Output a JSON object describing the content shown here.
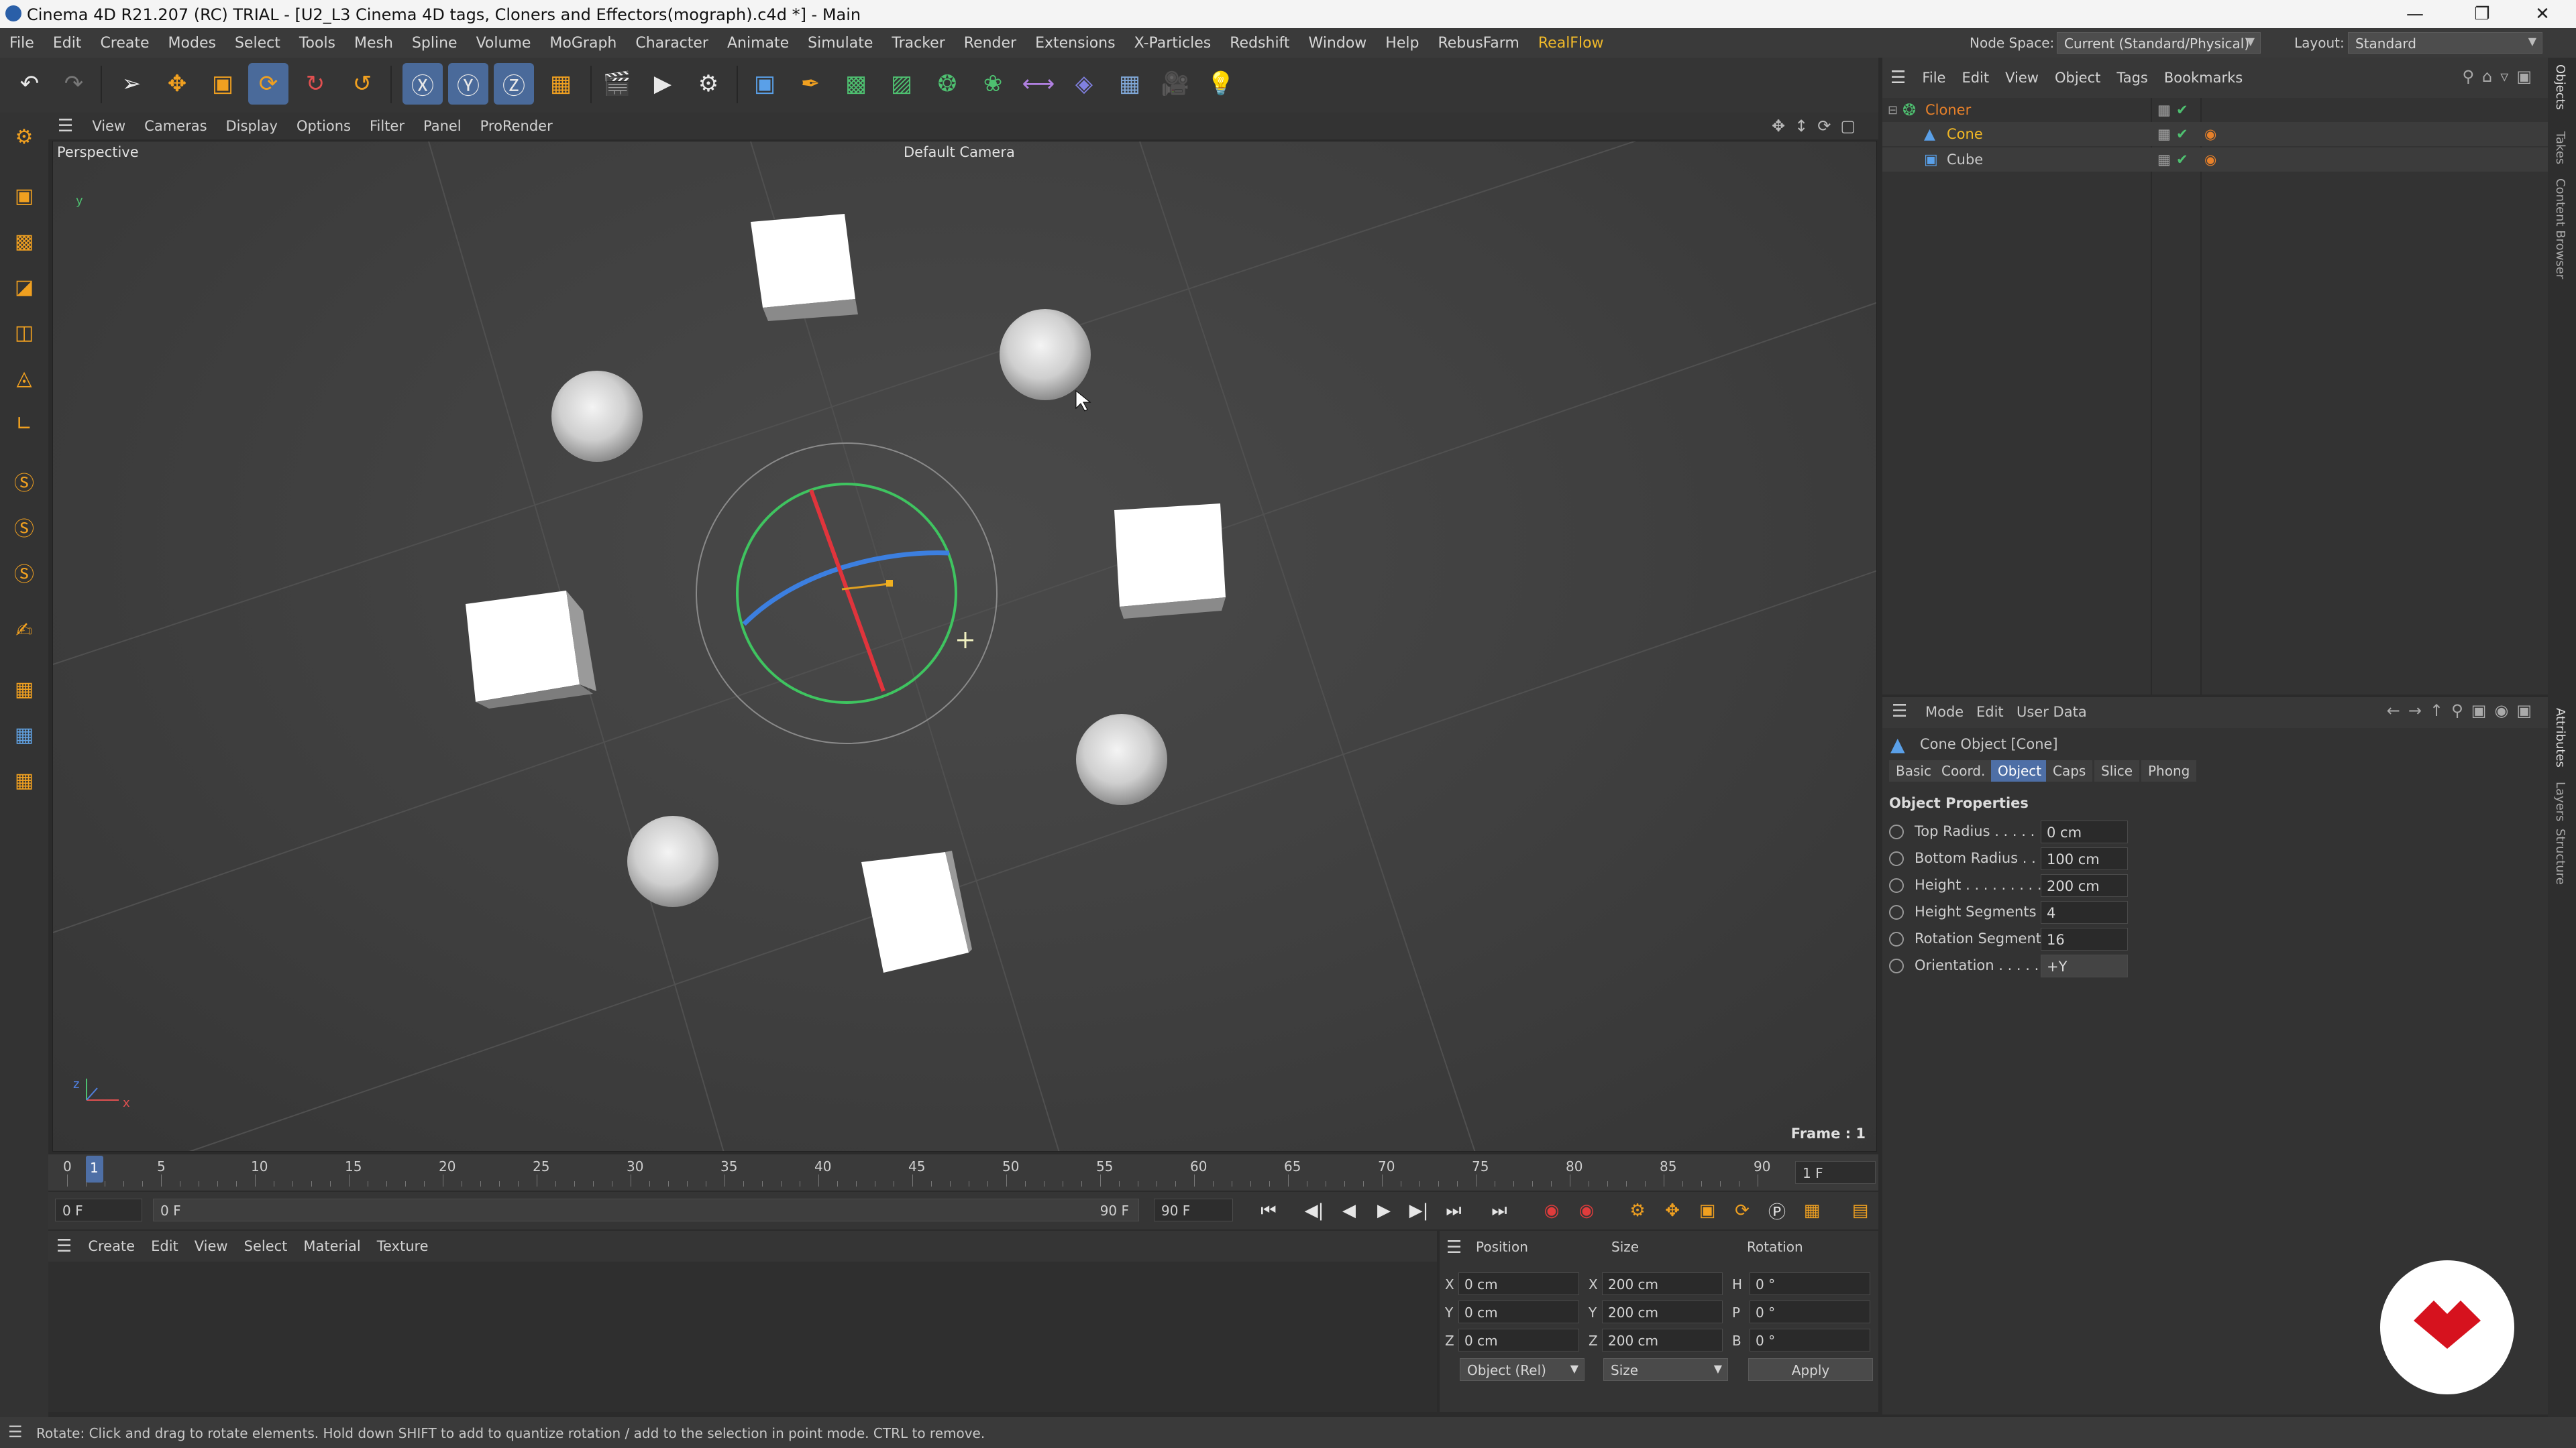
{
  "window": {
    "title": "Cinema 4D R21.207 (RC) TRIAL - [U2_L3 Cinema 4D tags, Cloners and Effectors(mograph).c4d *] - Main",
    "controls": [
      "minimize",
      "restore",
      "close"
    ]
  },
  "menubar": {
    "items": [
      "File",
      "Edit",
      "Create",
      "Modes",
      "Select",
      "Tools",
      "Mesh",
      "Spline",
      "Volume",
      "MoGraph",
      "Character",
      "Animate",
      "Simulate",
      "Tracker",
      "Render",
      "Extensions",
      "X-Particles",
      "Redshift",
      "Window",
      "Help",
      "RebusFarm",
      "RealFlow"
    ],
    "node_space_label": "Node Space:",
    "node_space_value": "Current (Standard/Physical)",
    "layout_label": "Layout:",
    "layout_value": "Standard"
  },
  "viewport": {
    "menu": [
      "View",
      "Cameras",
      "Display",
      "Options",
      "Filter",
      "Panel",
      "ProRender"
    ],
    "projection": "Perspective",
    "camera": "Default Camera",
    "frame_label": "Frame : 1",
    "axis_y": "y",
    "axis_x": "x",
    "axis_z": "z"
  },
  "timeline": {
    "ticks": [
      "0",
      "5",
      "10",
      "15",
      "20",
      "25",
      "30",
      "35",
      "40",
      "45",
      "50",
      "55",
      "60",
      "65",
      "70",
      "75",
      "80",
      "85",
      "90"
    ],
    "current_frame_marker": "1",
    "end_field": "1 F",
    "start_field": "0 F",
    "range_start": "0 F",
    "range_end": "90 F",
    "max_field": "90 F"
  },
  "material_manager": {
    "menu": [
      "Create",
      "Edit",
      "View",
      "Select",
      "Material",
      "Texture"
    ]
  },
  "coordinates": {
    "headers": [
      "Position",
      "Size",
      "Rotation"
    ],
    "rows": [
      {
        "axis": "X",
        "position": "0 cm",
        "size_axis": "X",
        "size": "200 cm",
        "rot_axis": "H",
        "rotation": "0 °"
      },
      {
        "axis": "Y",
        "position": "0 cm",
        "size_axis": "Y",
        "size": "200 cm",
        "rot_axis": "P",
        "rotation": "0 °"
      },
      {
        "axis": "Z",
        "position": "0 cm",
        "size_axis": "Z",
        "size": "200 cm",
        "rot_axis": "B",
        "rotation": "0 °"
      }
    ],
    "mode_select": "Object (Rel)",
    "size_select": "Size",
    "apply_label": "Apply"
  },
  "object_manager": {
    "menu": [
      "File",
      "Edit",
      "View",
      "Object",
      "Tags",
      "Bookmarks"
    ],
    "objects": [
      {
        "name": "Cloner",
        "color": "#e8812a"
      },
      {
        "name": "Cone",
        "color": "#f2b824"
      },
      {
        "name": "Cube",
        "color": "#c8c8c8"
      }
    ]
  },
  "attributes": {
    "menu": [
      "Mode",
      "Edit",
      "User Data"
    ],
    "object_title": "Cone Object [Cone]",
    "tabs": [
      "Basic",
      "Coord.",
      "Object",
      "Caps",
      "Slice",
      "Phong"
    ],
    "active_tab": "Object",
    "section": "Object Properties",
    "properties": [
      {
        "label": "Top Radius . . . . . .",
        "value": "0 cm"
      },
      {
        "label": "Bottom Radius . . .",
        "value": "100 cm"
      },
      {
        "label": "Height . . . . . . . . . .",
        "value": "200 cm"
      },
      {
        "label": "Height Segments",
        "value": "4"
      },
      {
        "label": "Rotation Segments",
        "value": "16"
      },
      {
        "label": "Orientation . . . . . .",
        "value": "+Y"
      }
    ]
  },
  "right_strip": {
    "tabs_top": [
      "Objects",
      "Takes",
      "Content Browser"
    ],
    "tabs_bottom": [
      "Attributes",
      "Layers",
      "Structure"
    ]
  },
  "status": {
    "text": "Rotate: Click and drag to rotate elements. Hold down SHIFT to add to quantize rotation / add to the selection in point mode. CTRL to remove."
  },
  "colors": {
    "accent_selected": "#4e6fa6",
    "cloner_orange": "#e8812a",
    "realflow_yellow": "#f0b92a",
    "logo_red": "#d6121e"
  }
}
